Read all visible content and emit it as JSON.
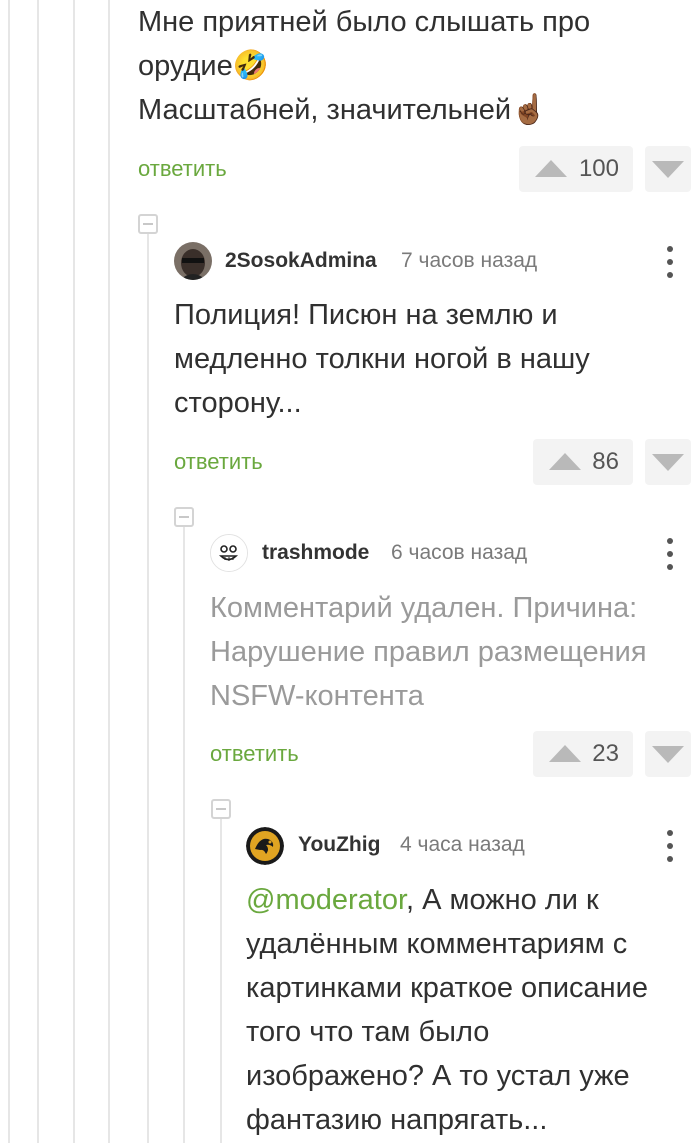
{
  "comment0": {
    "line1": "Мне приятней было слышать про",
    "line2": "орудие🤣",
    "line3": "Масштабней, значительней☝🏾",
    "reply_label": "ответить",
    "score": "100"
  },
  "comment1": {
    "author": "2SosokAdmina",
    "time": "7 часов назад",
    "line1": "Полиция! Писюн на землю и",
    "line2": "медленно толкни ногой в нашу",
    "line3": "сторону...",
    "reply_label": "ответить",
    "score": "86"
  },
  "comment2": {
    "author": "trashmode",
    "time": "6 часов назад",
    "line1": "Комментарий удален. Причина:",
    "line2": "Нарушение правил размещения",
    "line3": "NSFW-контента",
    "reply_label": "ответить",
    "score": "23"
  },
  "comment3": {
    "author": "YouZhig",
    "time": "4 часа назад",
    "mention": "@moderator",
    "line1_rest": ", А можно ли к",
    "line2": "удалённым комментариям с",
    "line3": "картинками краткое описание",
    "line4": "того что там было",
    "line5": "изображено? А то устал уже",
    "line6": "фантазию напрягать..."
  },
  "colors": {
    "accent_green": "#6aa83e",
    "deleted_text": "#9a9a9a",
    "thread_line": "#e6e6e6"
  }
}
